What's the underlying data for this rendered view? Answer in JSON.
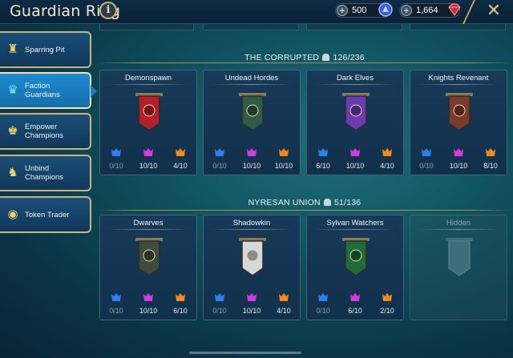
{
  "header": {
    "title": "Guardian Ring",
    "info_symbol": "i",
    "currencies": [
      {
        "amount": "500",
        "icon": "ancient-shard-icon",
        "color": "#4f7be8"
      },
      {
        "amount": "1,664",
        "icon": "gem-icon",
        "color": "#d22c3c"
      }
    ],
    "close_symbol": "✕"
  },
  "sidebar": {
    "items": [
      {
        "label": "Sparring Pit",
        "icon": "sparring-pit-icon",
        "active": false
      },
      {
        "label": "Faction Guardians",
        "icon": "faction-guardians-icon",
        "active": true
      },
      {
        "label": "Empower Champions",
        "icon": "empower-icon",
        "active": false
      },
      {
        "label": "Unbind Champions",
        "icon": "unbind-icon",
        "active": false
      },
      {
        "label": "Token Trader",
        "icon": "token-icon",
        "active": false
      }
    ]
  },
  "sections": [
    {
      "name": "THE CORRUPTED",
      "count": "126/236",
      "cards": [
        {
          "name": "Demonspawn",
          "banner_color": "#b3202c",
          "values": [
            "0/10",
            "10/10",
            "4/10"
          ]
        },
        {
          "name": "Undead Hordes",
          "banner_color": "#2f5a45",
          "values": [
            "0/10",
            "10/10",
            "10/10"
          ]
        },
        {
          "name": "Dark Elves",
          "banner_color": "#6a3bb0",
          "values": [
            "6/10",
            "10/10",
            "4/10"
          ]
        },
        {
          "name": "Knights Revenant",
          "banner_color": "#7a3a2c",
          "values": [
            "0/10",
            "10/10",
            "8/10"
          ]
        }
      ]
    },
    {
      "name": "NYRESAN UNION",
      "count": "51/136",
      "cards": [
        {
          "name": "Dwarves",
          "banner_color": "#3e4b3e",
          "values": [
            "0/10",
            "10/10",
            "6/10"
          ]
        },
        {
          "name": "Shadowkin",
          "banner_color": "#d8d8d8",
          "values": [
            "0/10",
            "10/10",
            "4/10"
          ]
        },
        {
          "name": "Sylvan Watchers",
          "banner_color": "#1f6b3a",
          "values": [
            "0/10",
            "6/10",
            "2/10"
          ]
        },
        {
          "name": "Hidden",
          "banner_color": "#3d6e79",
          "values": [],
          "hidden": true
        }
      ]
    }
  ],
  "tier_colors": [
    "#2f7ff0",
    "#d13ee0",
    "#f08a1e"
  ]
}
